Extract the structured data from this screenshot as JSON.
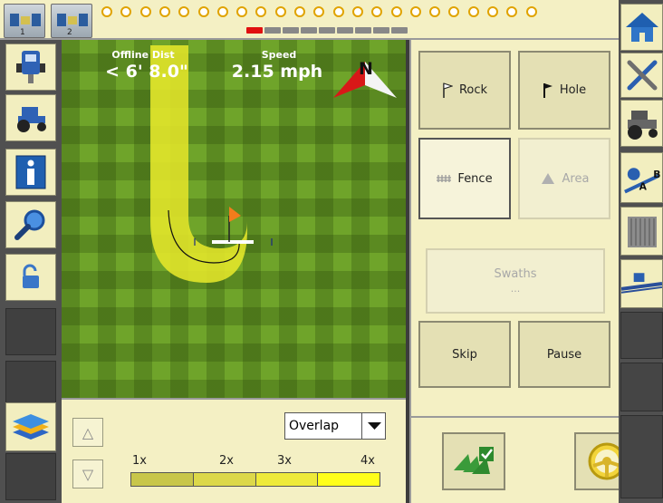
{
  "map": {
    "offline_dist_label": "Offline Dist",
    "offline_dist_value": "< 6' 8.0\"",
    "speed_label": "Speed",
    "speed_value": "2.15 mph",
    "compass_letter": "N"
  },
  "statusbar": {
    "led_count": 23,
    "active_segment": 0
  },
  "buttons": {
    "rock": "Rock",
    "hole": "Hole",
    "fence": "Fence",
    "area": "Area",
    "swaths": "Swaths",
    "swaths_sub": "...",
    "skip": "Skip",
    "pause": "Pause"
  },
  "overlap": {
    "selected": "Overlap",
    "scale": [
      "1x",
      "2x",
      "3x",
      "4x"
    ],
    "scale_colors": [
      "#c8c64a",
      "#dcd84a",
      "#eeea3a",
      "#ffff1a"
    ]
  },
  "colors": {
    "panel": "#f4f0c4",
    "coverage": "#eaea2a",
    "field": "#6fa42a"
  },
  "icons": {
    "left_nav": [
      "implement-icon",
      "tractor-icon",
      "info-icon",
      "magnifier-icon",
      "unlock-icon"
    ],
    "far_right": [
      "home-icon",
      "tools-icon",
      "tractor-icon",
      "ab-line-icon",
      "product-bin-icon",
      "boom-icon"
    ]
  }
}
